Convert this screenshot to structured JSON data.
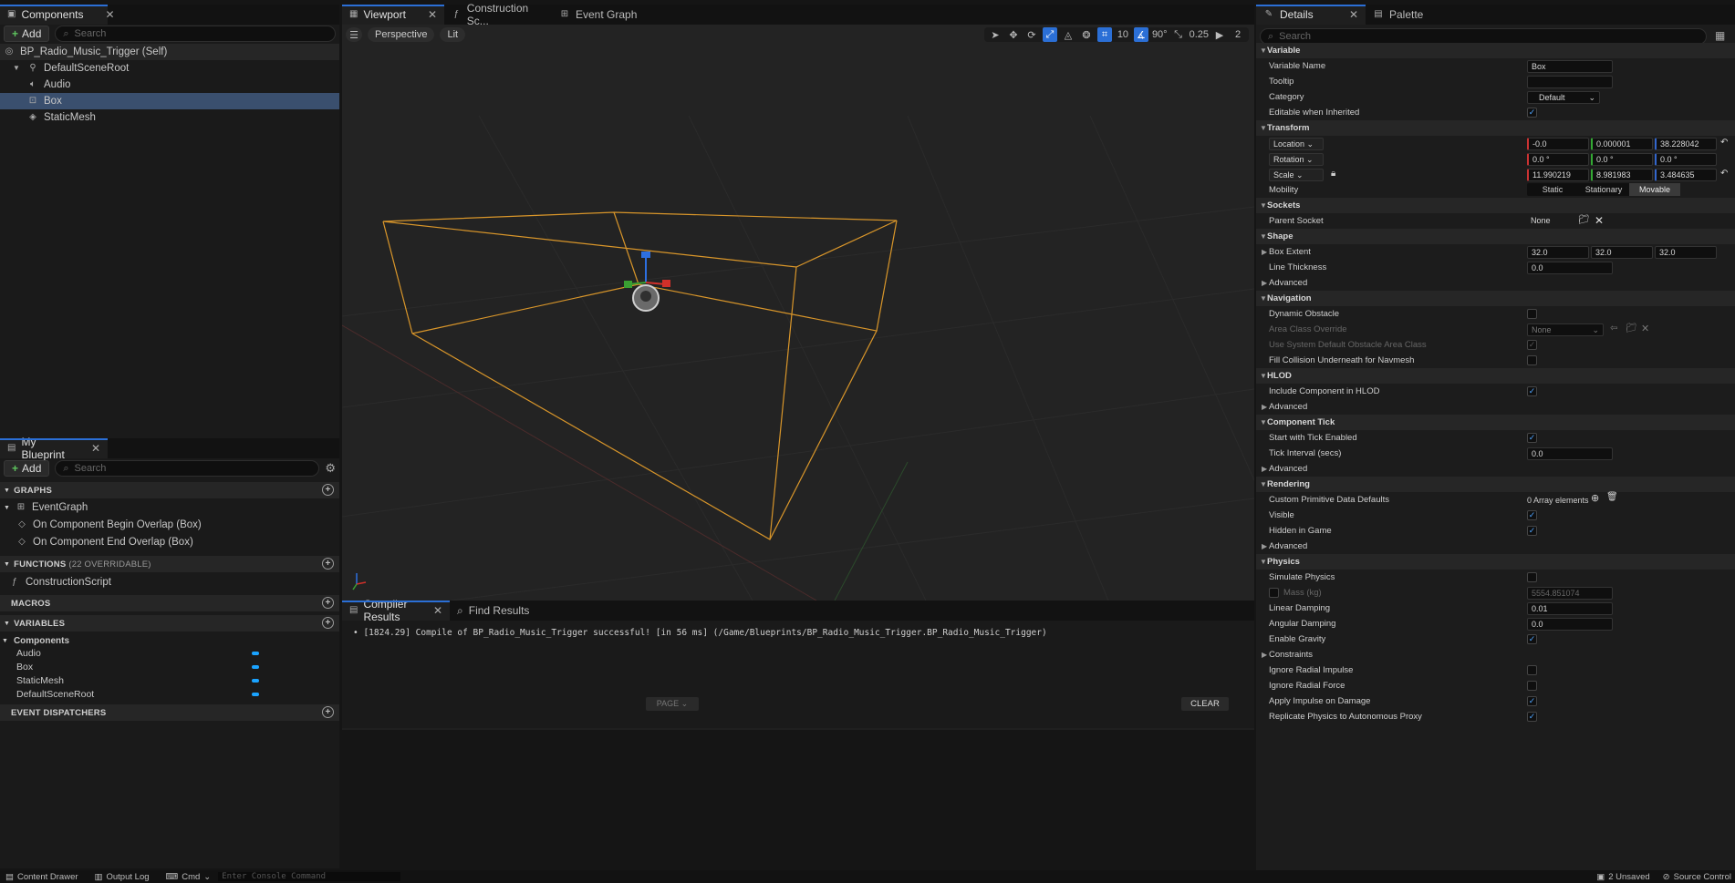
{
  "components_panel": {
    "tab": "Components",
    "add": "Add",
    "search_placeholder": "Search",
    "tree": [
      {
        "label": "BP_Radio_Music_Trigger (Self)"
      },
      {
        "label": "DefaultSceneRoot"
      },
      {
        "label": "Audio"
      },
      {
        "label": "Box"
      },
      {
        "label": "StaticMesh"
      }
    ]
  },
  "viewport_tabs": [
    {
      "label": "Viewport"
    },
    {
      "label": "Construction Sc..."
    },
    {
      "label": "Event Graph"
    }
  ],
  "viewport_toolbar": {
    "perspective": "Perspective",
    "lit": "Lit",
    "grid": "10",
    "angle": "90°",
    "scale": "0.25",
    "camera": "2"
  },
  "my_blueprint": {
    "tab": "My Blueprint",
    "add": "Add",
    "search_placeholder": "Search",
    "graphs_label": "GRAPHS",
    "event_graph": "EventGraph",
    "events": [
      "On Component Begin Overlap (Box)",
      "On Component End Overlap (Box)"
    ],
    "functions_label": "FUNCTIONS",
    "functions_count": "(22 OVERRIDABLE)",
    "construction_script": "ConstructionScript",
    "macros_label": "MACROS",
    "variables_label": "VARIABLES",
    "components_label": "Components",
    "variables": [
      "Audio",
      "Box",
      "StaticMesh",
      "DefaultSceneRoot"
    ],
    "dispatchers_label": "EVENT DISPATCHERS"
  },
  "compiler": {
    "tab": "Compiler Results",
    "find_tab": "Find Results",
    "message": "[1824.29] Compile of BP_Radio_Music_Trigger successful! [in 56 ms] (/Game/Blueprints/BP_Radio_Music_Trigger.BP_Radio_Music_Trigger)",
    "page": "PAGE",
    "clear": "CLEAR"
  },
  "details": {
    "tab": "Details",
    "palette_tab": "Palette",
    "search_placeholder": "Search",
    "variable_sec": "Variable",
    "variable_name_lbl": "Variable Name",
    "variable_name": "Box",
    "tooltip_lbl": "Tooltip",
    "category_lbl": "Category",
    "category": "Default",
    "editable_lbl": "Editable when Inherited",
    "transform_sec": "Transform",
    "location_lbl": "Location",
    "location": [
      "-0.0",
      "0.000001",
      "38.228042"
    ],
    "rotation_lbl": "Rotation",
    "rotation": [
      "0.0 °",
      "0.0 °",
      "0.0 °"
    ],
    "scale_lbl": "Scale",
    "scale": [
      "11.990219",
      "8.981983",
      "3.484635"
    ],
    "mobility_lbl": "Mobility",
    "mobility": [
      "Static",
      "Stationary",
      "Movable"
    ],
    "sockets_sec": "Sockets",
    "parent_socket_lbl": "Parent Socket",
    "parent_socket": "None",
    "shape_sec": "Shape",
    "box_extent_lbl": "Box Extent",
    "box_extent": [
      "32.0",
      "32.0",
      "32.0"
    ],
    "line_thickness_lbl": "Line Thickness",
    "line_thickness": "0.0",
    "advanced": "Advanced",
    "navigation_sec": "Navigation",
    "dynamic_obstacle_lbl": "Dynamic Obstacle",
    "area_class_lbl": "Area Class Override",
    "area_class": "None",
    "use_system_lbl": "Use System Default Obstacle Area Class",
    "fill_collision_lbl": "Fill Collision Underneath for Navmesh",
    "hlod_sec": "HLOD",
    "include_hlod_lbl": "Include Component in HLOD",
    "tick_sec": "Component Tick",
    "start_tick_lbl": "Start with Tick Enabled",
    "tick_interval_lbl": "Tick Interval (secs)",
    "tick_interval": "0.0",
    "rendering_sec": "Rendering",
    "custom_prim_lbl": "Custom Primitive Data Defaults",
    "custom_prim": "0 Array elements",
    "visible_lbl": "Visible",
    "hidden_lbl": "Hidden in Game",
    "physics_sec": "Physics",
    "simulate_lbl": "Simulate Physics",
    "mass_lbl": "Mass (kg)",
    "mass": "5554.851074",
    "linear_damping_lbl": "Linear Damping",
    "linear_damping": "0.01",
    "angular_damping_lbl": "Angular Damping",
    "angular_damping": "0.0",
    "gravity_lbl": "Enable Gravity",
    "constraints": "Constraints",
    "radial_impulse_lbl": "Ignore Radial Impulse",
    "radial_force_lbl": "Ignore Radial Force",
    "impulse_damage_lbl": "Apply Impulse on Damage",
    "replicate_lbl": "Replicate Physics to Autonomous Proxy"
  },
  "statusbar": {
    "content_drawer": "Content Drawer",
    "output_log": "Output Log",
    "cmd": "Cmd",
    "console_placeholder": "Enter Console Command",
    "unsaved": "2 Unsaved",
    "source_control": "Source Control"
  }
}
